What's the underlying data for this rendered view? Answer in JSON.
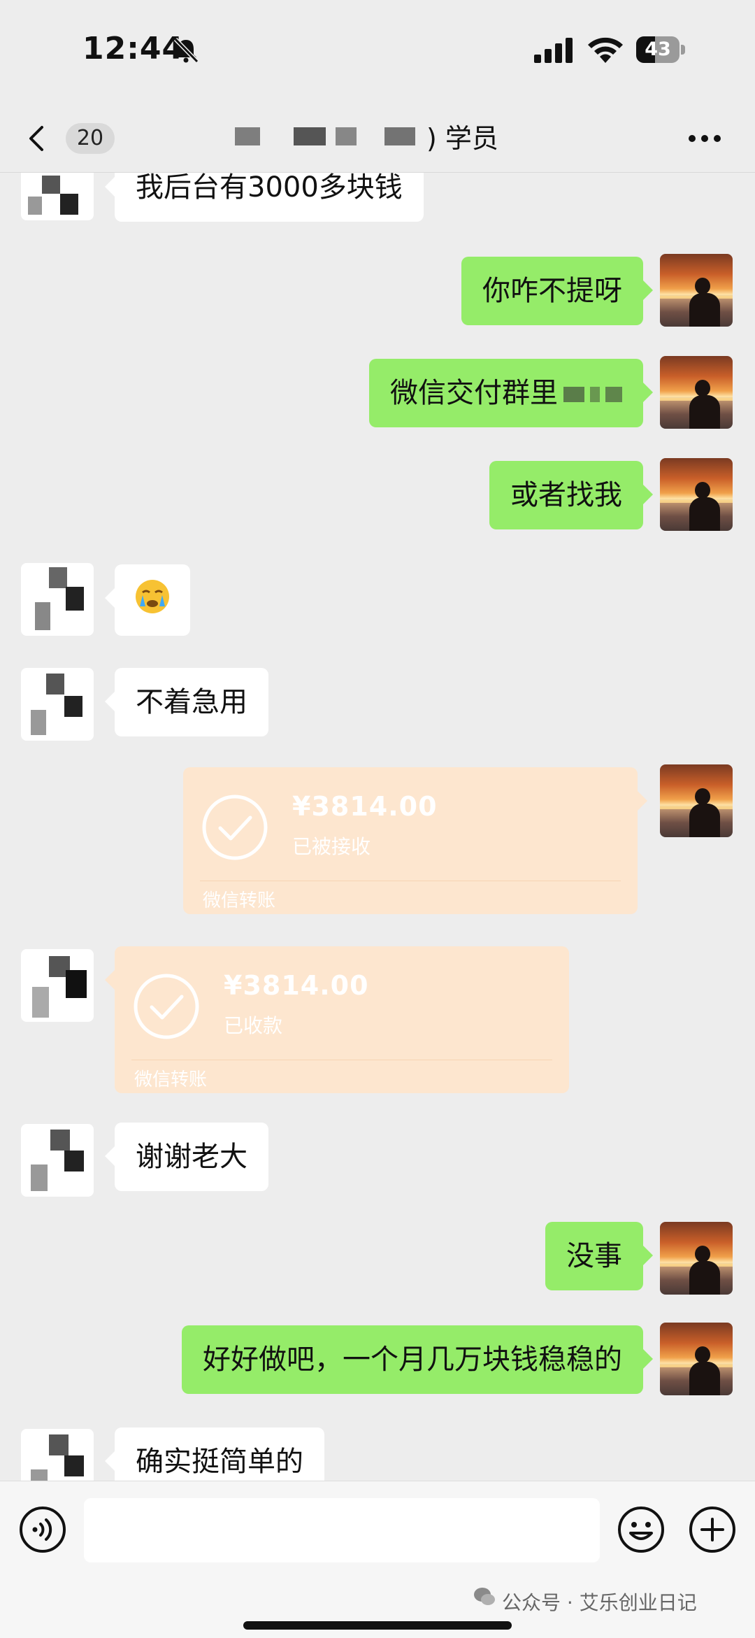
{
  "status_bar": {
    "time": "12:44",
    "battery_label": "43",
    "battery_level_percent": 43
  },
  "nav": {
    "unread_count": "20",
    "title_visible": ") 学员"
  },
  "messages": [
    {
      "side": "left",
      "type": "text",
      "text": "我后台有3000多块钱"
    },
    {
      "side": "right",
      "type": "text",
      "text": "你咋不提呀"
    },
    {
      "side": "right",
      "type": "text",
      "text": "微信交付群里"
    },
    {
      "side": "right",
      "type": "text",
      "text": "或者找我"
    },
    {
      "side": "left",
      "type": "emoji",
      "emoji": "😭"
    },
    {
      "side": "left",
      "type": "text",
      "text": "不着急用"
    },
    {
      "side": "right",
      "type": "transfer",
      "amount": "¥3814.00",
      "status": "已被接收",
      "footer": "微信转账"
    },
    {
      "side": "left",
      "type": "transfer",
      "amount": "¥3814.00",
      "status": "已收款",
      "footer": "微信转账"
    },
    {
      "side": "left",
      "type": "text",
      "text": "谢谢老大"
    },
    {
      "side": "right",
      "type": "text",
      "text": "没事"
    },
    {
      "side": "right",
      "type": "text",
      "text": "好好做吧，一个月几万块钱稳稳的"
    },
    {
      "side": "left",
      "type": "text",
      "text": "确实挺简单的"
    }
  ],
  "input_bar": {
    "message_value": "",
    "watermark": "公众号 · 艾乐创业日记"
  },
  "colors": {
    "background": "#ededed",
    "sent_bubble": "#95ec69",
    "received_bubble": "#ffffff",
    "transfer_card": "#fde6cf"
  },
  "icons": [
    "bell-slash-icon",
    "signal-icon",
    "wifi-icon",
    "battery-icon",
    "back-chevron-icon",
    "more-icon",
    "check-circle-icon",
    "voice-icon",
    "emoji-icon",
    "plus-icon",
    "wechat-watermark-icon"
  ]
}
